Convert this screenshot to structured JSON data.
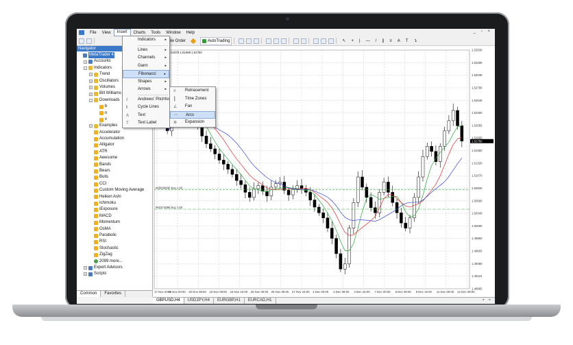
{
  "menubar": {
    "items": [
      "File",
      "View",
      "Insert",
      "Charts",
      "Tools",
      "Window",
      "Help"
    ],
    "open_item": "Insert",
    "window_controls": "_ ▫ ×"
  },
  "toolbar": {
    "new_order": "New Order",
    "auto_trading": "AutoTrading"
  },
  "navigator": {
    "title": "Navigator",
    "tree": [
      {
        "label": "MetaTrader 4",
        "level": 0,
        "icon": "monitor-icon",
        "selected": true
      },
      {
        "label": "Accounts",
        "level": 1,
        "icon": "accounts-icon",
        "expander": "+"
      },
      {
        "label": "Indicators",
        "level": 1,
        "icon": "folder-icon",
        "expander": "-"
      },
      {
        "label": "Trend",
        "level": 2,
        "icon": "folder-icon",
        "expander": "+"
      },
      {
        "label": "Oscillators",
        "level": 2,
        "icon": "folder-icon",
        "expander": "+"
      },
      {
        "label": "Volumes",
        "level": 2,
        "icon": "folder-icon",
        "expander": "+"
      },
      {
        "label": "Bill Williams",
        "level": 2,
        "icon": "folder-icon",
        "expander": "+"
      },
      {
        "label": "Downloads",
        "level": 2,
        "icon": "folder-icon",
        "expander": "-"
      },
      {
        "label": "b",
        "level": 3,
        "icon": "indicator-icon"
      },
      {
        "label": "n",
        "level": 3,
        "icon": "indicator-icon"
      },
      {
        "label": "v",
        "level": 3,
        "icon": "indicator-icon"
      },
      {
        "label": "Examples",
        "level": 2,
        "icon": "folder-icon",
        "expander": "+"
      },
      {
        "label": "Accelerator",
        "level": 2,
        "icon": "indicator-icon"
      },
      {
        "label": "Accumulation",
        "level": 2,
        "icon": "indicator-icon"
      },
      {
        "label": "Alligator",
        "level": 2,
        "icon": "indicator-icon"
      },
      {
        "label": "ATR",
        "level": 2,
        "icon": "indicator-icon"
      },
      {
        "label": "Awesome",
        "level": 2,
        "icon": "indicator-icon"
      },
      {
        "label": "Bands",
        "level": 2,
        "icon": "indicator-icon"
      },
      {
        "label": "Bears",
        "level": 2,
        "icon": "indicator-icon"
      },
      {
        "label": "Bulls",
        "level": 2,
        "icon": "indicator-icon"
      },
      {
        "label": "CCI",
        "level": 2,
        "icon": "indicator-icon"
      },
      {
        "label": "Custom Moving Average",
        "level": 2,
        "icon": "indicator-icon"
      },
      {
        "label": "Heiken Ashi",
        "level": 2,
        "icon": "indicator-icon"
      },
      {
        "label": "Ichimoku",
        "level": 2,
        "icon": "indicator-icon"
      },
      {
        "label": "iExposure",
        "level": 2,
        "icon": "indicator-icon"
      },
      {
        "label": "MACD",
        "level": 2,
        "icon": "indicator-icon"
      },
      {
        "label": "Momentum",
        "level": 2,
        "icon": "indicator-icon"
      },
      {
        "label": "OsMA",
        "level": 2,
        "icon": "indicator-icon"
      },
      {
        "label": "Parabolic",
        "level": 2,
        "icon": "indicator-icon"
      },
      {
        "label": "RSI",
        "level": 2,
        "icon": "indicator-icon"
      },
      {
        "label": "Stochastic",
        "level": 2,
        "icon": "indicator-icon"
      },
      {
        "label": "ZigZag",
        "level": 2,
        "icon": "indicator-icon"
      },
      {
        "label": "2099 more...",
        "level": 2,
        "icon": "more-icon"
      },
      {
        "label": "Expert Advisors",
        "level": 1,
        "icon": "expert-icon",
        "expander": "+"
      },
      {
        "label": "Scripts",
        "level": 1,
        "icon": "scripts-icon",
        "expander": "+"
      }
    ],
    "tabs": [
      "Common",
      "Favorites"
    ],
    "active_tab": "Common"
  },
  "insert_menu": {
    "items": [
      {
        "label": "Indicators",
        "submenu": true
      },
      {
        "sep": true
      },
      {
        "label": "Lines",
        "submenu": true
      },
      {
        "label": "Channels",
        "submenu": true
      },
      {
        "label": "Gann",
        "submenu": true
      },
      {
        "label": "Fibonacci",
        "submenu": true,
        "highlight": true
      },
      {
        "label": "Shapes",
        "submenu": true
      },
      {
        "label": "Arrows",
        "submenu": true
      },
      {
        "sep": true
      },
      {
        "label": "Andrews' Pitchfork",
        "icon": "pitchfork-icon"
      },
      {
        "label": "Cycle Lines",
        "icon": "cycle-lines-icon"
      },
      {
        "label": "Text",
        "icon": "text-icon"
      },
      {
        "label": "Text Label",
        "icon": "text-label-icon"
      }
    ]
  },
  "fibonacci_menu": {
    "items": [
      {
        "label": "Retracement",
        "icon": "retracement-icon"
      },
      {
        "label": "Time Zones",
        "icon": "time-zones-icon"
      },
      {
        "label": "Fan",
        "icon": "fan-icon"
      },
      {
        "label": "Arcs",
        "icon": "arcs-icon",
        "highlight": true
      },
      {
        "label": "Expansion",
        "icon": "expansion-icon"
      }
    ]
  },
  "chart": {
    "ohlc_header": "1.51967 1.51978 1.51688 1.51750",
    "current_price": "1.51750",
    "orders": [
      {
        "label": "#65839836 buy 1.00",
        "price": 1.508
      },
      {
        "label": "#63374898 buy 1.00",
        "price": 1.5042
      }
    ],
    "tabs": [
      "GBPUSD,H4",
      "USDJPY,H4",
      "EURGBP,H1",
      "EURCAD,H1"
    ],
    "active_tab": "GBPUSD,H4",
    "colors": {
      "ma_blue": "#3344dd",
      "ma_red": "#dd3030",
      "ma_green": "#22aa33",
      "order_line": "#33aa33",
      "grid": "#c8c8c8"
    }
  },
  "chart_data": {
    "type": "candlestick",
    "symbol": "GBPUSD,H4",
    "y_ticks": [
      "1.53530",
      "1.53285",
      "1.53035",
      "1.52790",
      "1.52545",
      "1.52300",
      "1.52055",
      "1.51805",
      "1.51560",
      "1.51320",
      "1.51070",
      "1.50830",
      "1.50580",
      "1.50340",
      "1.50090",
      "1.49850",
      "1.49605",
      "1.49360",
      "1.49115",
      "1.48865"
    ],
    "ylim": [
      1.48865,
      1.5353
    ],
    "x_ticks": [
      "17 Nov 2015",
      "19 Nov 00:00",
      "20 Nov 08:00",
      "23 Nov 08:00",
      "23 Nov 16:00",
      "25 Nov 00:00",
      "26 Nov 08:00",
      "27 Nov 16:00",
      "1 Dec 00:00",
      "2 Dec 08:00",
      "3 Dec 16:00",
      "7 Dec 00:00",
      "8 Dec 08:00",
      "9 Dec 16:00",
      "11 Dec 00:00",
      "14 Dec 08:00"
    ],
    "closes": [
      1.5195,
      1.521,
      1.5225,
      1.5235,
      1.5228,
      1.524,
      1.5222,
      1.5205,
      1.5185,
      1.517,
      1.516,
      1.515,
      1.5138,
      1.513,
      1.512,
      1.511,
      1.5098,
      1.509,
      1.5075,
      1.5065,
      1.5082,
      1.5088,
      1.5077,
      1.5068,
      1.5085,
      1.5092,
      1.5095,
      1.5079,
      1.507,
      1.508,
      1.5088,
      1.5082,
      1.5075,
      1.506,
      1.5046,
      1.5035,
      1.5025,
      1.5005,
      1.4985,
      1.4955,
      1.4925,
      1.4935,
      1.5005,
      1.5055,
      1.5105,
      1.5085,
      1.5065,
      1.5045,
      1.5035,
      1.5075,
      1.5095,
      1.5075,
      1.5055,
      1.5035,
      1.5015,
      1.5005,
      1.5025,
      1.5065,
      1.5105,
      1.5145,
      1.5165,
      1.5155,
      1.5135,
      1.5165,
      1.5195,
      1.5215,
      1.5235,
      1.5205,
      1.5175
    ]
  }
}
